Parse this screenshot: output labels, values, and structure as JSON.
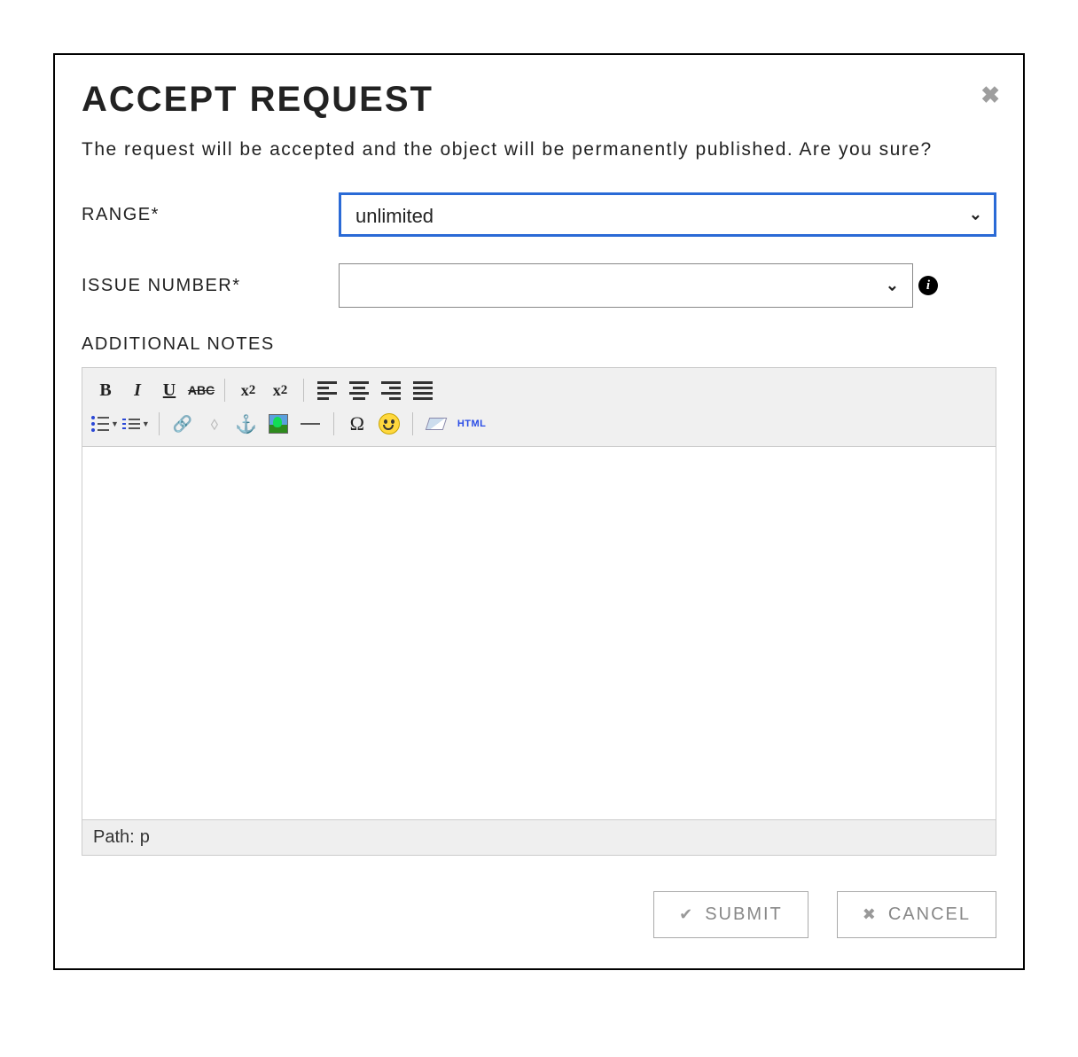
{
  "dialog": {
    "title": "ACCEPT REQUEST",
    "description": "The request will be accepted and the object will be permanently published. Are you sure?"
  },
  "fields": {
    "range": {
      "label": "RANGE*",
      "value": "unlimited"
    },
    "issue_number": {
      "label": "ISSUE NUMBER*",
      "value": ""
    },
    "notes": {
      "label": "ADDITIONAL NOTES"
    }
  },
  "editor": {
    "status_prefix": "Path:",
    "status_node": "p",
    "toolbar": {
      "bold": "B",
      "italic": "I",
      "underline": "U",
      "strike": "ABC",
      "sub": "x",
      "sub_suffix": "2",
      "sup": "x",
      "sup_suffix": "2",
      "omega": "Ω",
      "html": "HTML",
      "anchor": "⚓",
      "link": "🔗",
      "unlink": "✂"
    }
  },
  "buttons": {
    "submit": "SUBMIT",
    "cancel": "CANCEL"
  },
  "icons": {
    "check": "✔",
    "close_x": "✖",
    "info": "i"
  }
}
